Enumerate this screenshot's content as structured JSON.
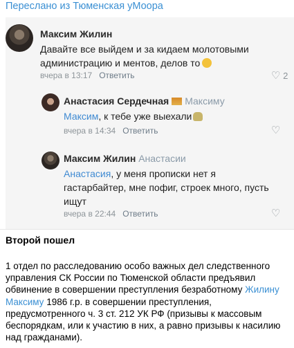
{
  "forwarded_from": "Переслано из Тюменская уМоора",
  "comments": [
    {
      "author": "Максим Жилин",
      "text": "Давайте все выйдем и за кидаем молотовыми администрацию и ментов, делов то",
      "time": "вчера в 13:17",
      "reply_label": "Ответить",
      "likes": "2"
    },
    {
      "author": "Анастасия Сердечная",
      "reply_to": "Максиму",
      "mention": "Максим",
      "text": ", к тебе уже выехали",
      "time": "вчера в 14:34",
      "reply_label": "Ответить"
    },
    {
      "author": "Максим Жилин",
      "reply_to": "Анастасии",
      "mention": "Анастасия",
      "text": ", у меня прописки нет я гастарбайтер, мне пофиг, строек много, пусть ищут",
      "time": "вчера в 22:44",
      "reply_label": "Ответить"
    }
  ],
  "post": {
    "title": "Второй пошел",
    "body_before": "1 отдел по расследованию особо важных дел следственного управления СК России по Тюменской области предъявил обвинение в совершении преступления безработному ",
    "link_text": "Жилину Максиму",
    "body_after": " 1986 г.р. в совершении преступления, предусмотренного ч. 3 ст. 212 УК РФ (призывы к массовым беспорядкам, или к участию в них, а равно призывы к насилию над гражданами)."
  },
  "colors": {
    "link": "#3a8fd3",
    "mention": "#3f8ad2",
    "meta": "#8d9499",
    "screenshot_bg": "#f5f5f5"
  },
  "icons": {
    "like": "heart-icon",
    "emoji1": "face-emoji-icon",
    "emoji2": "skull-emoji-icon",
    "flag": "flag-icon"
  }
}
